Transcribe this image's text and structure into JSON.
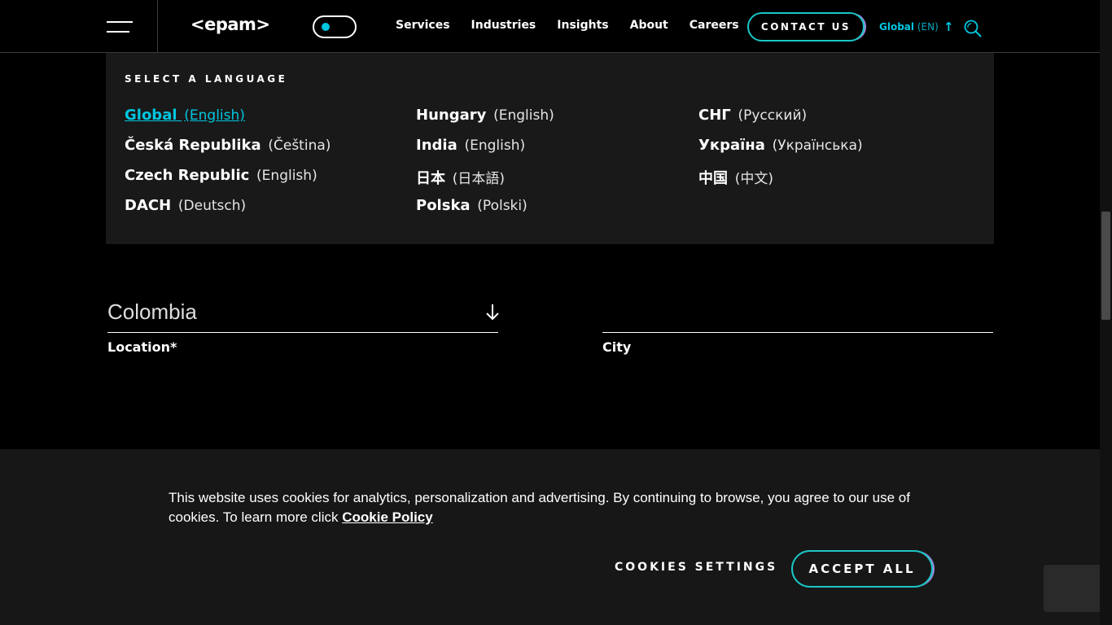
{
  "header": {
    "logo": "<epam>",
    "nav": [
      "Services",
      "Industries",
      "Insights",
      "About",
      "Careers"
    ],
    "contact_label": "CONTACT US",
    "lang_region": "Global",
    "lang_code": "(EN)"
  },
  "language_panel": {
    "heading": "SELECT A LANGUAGE",
    "columns": [
      [
        {
          "name": "Global",
          "sub": "(English)"
        },
        {
          "name": "Česká Republika",
          "sub": "(Čeština)"
        },
        {
          "name": "Czech Republic",
          "sub": "(English)"
        },
        {
          "name": "DACH",
          "sub": "(Deutsch)"
        }
      ],
      [
        {
          "name": "Hungary",
          "sub": "(English)"
        },
        {
          "name": "India",
          "sub": "(English)"
        },
        {
          "name": "日本",
          "sub": "(日本語)"
        },
        {
          "name": "Polska",
          "sub": "(Polski)"
        }
      ],
      [
        {
          "name": "СНГ",
          "sub": "(Русский)"
        },
        {
          "name": "Україна",
          "sub": "(Українська)"
        },
        {
          "name": "中国",
          "sub": "(中文)"
        }
      ]
    ]
  },
  "form": {
    "location_value": "Colombia",
    "location_label": "Location*",
    "city_label": "City"
  },
  "cookie_banner": {
    "text": "This website uses cookies for analytics, personalization and advertising. By continuing to browse, you agree to our use of cookies. To learn more click ",
    "link": "Cookie Policy",
    "settings_label": "COOKIES SETTINGS",
    "accept_label": "ACCEPT ALL"
  },
  "colors": {
    "accent": "#00c6e0",
    "button_gradient_end": "#a58ce6",
    "background": "#000000",
    "panel": "#1a1a1a"
  }
}
